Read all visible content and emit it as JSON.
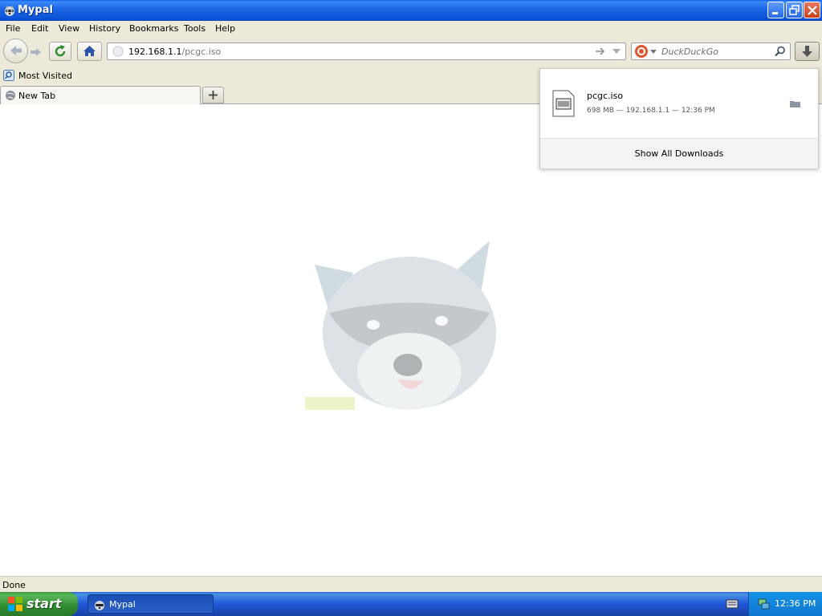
{
  "window": {
    "title": "Mypal"
  },
  "menu": [
    "File",
    "Edit",
    "View",
    "History",
    "Bookmarks",
    "Tools",
    "Help"
  ],
  "address": {
    "host": "192.168.1.1",
    "path": "/pcgc.iso"
  },
  "search": {
    "placeholder": "DuckDuckGo"
  },
  "bookmarks": {
    "most_visited": "Most Visited"
  },
  "tabs": [
    {
      "label": "New Tab"
    }
  ],
  "downloads": {
    "filename": "pcgc.iso",
    "meta": "698 MB — 192.168.1.1 — 12:36 PM",
    "show_all": "Show All Downloads"
  },
  "status": {
    "text": "Done"
  },
  "taskbar": {
    "start": "start",
    "task": "Mypal",
    "clock": "12:36 PM"
  },
  "colors": {
    "titlebar": "#0c55d8",
    "chrome": "#ece9d8",
    "taskbar": "#245edb",
    "start": "#3c9a3c"
  }
}
